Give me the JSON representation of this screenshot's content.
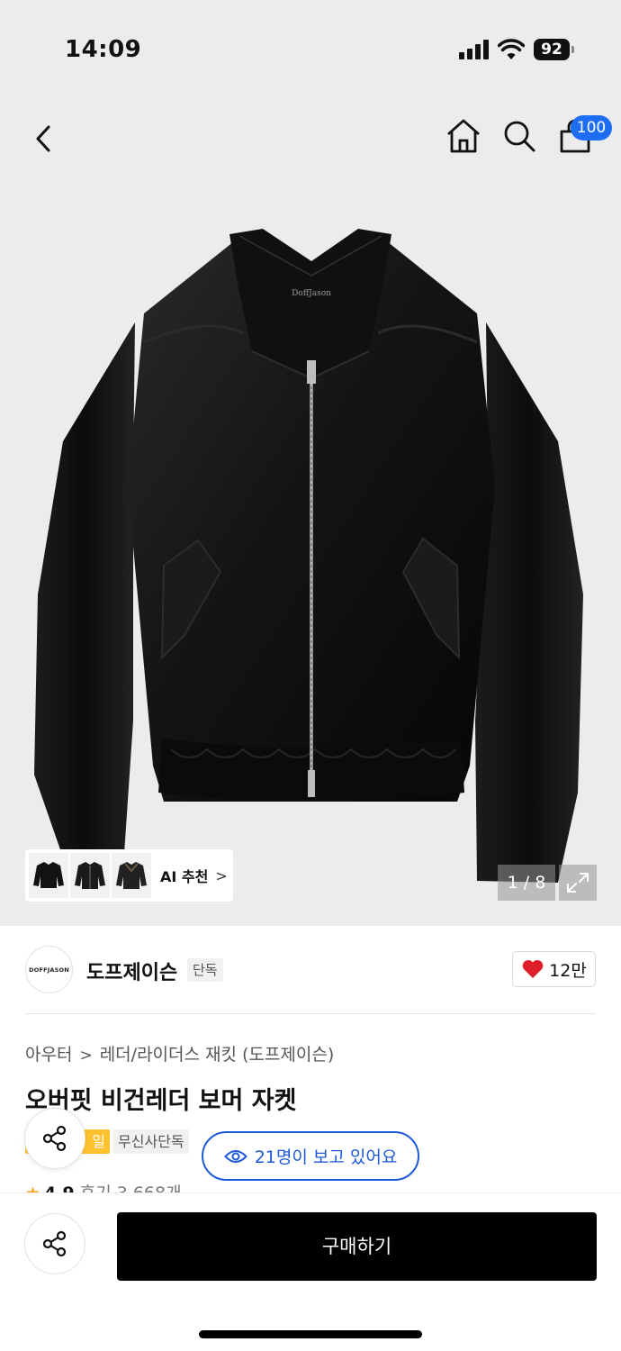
{
  "status": {
    "time": "14:09",
    "battery": "92"
  },
  "header": {
    "cart_count": "100"
  },
  "gallery": {
    "ai_label": "AI 추천",
    "ai_chevron": ">",
    "page_indicator": "1 / 8",
    "product_logo_text": "DoffJason"
  },
  "brand": {
    "logo_text": "DOFFJASON",
    "name": "도프제이슨",
    "tag": "단독",
    "likes": "12만"
  },
  "product": {
    "breadcrumb": [
      "아우터",
      "레더/라이더스 재킷 (도프제이슨)"
    ],
    "breadcrumb_sep": ">",
    "title": "오버핏 비건레더 보머 자켓",
    "badge_sale": "일",
    "badge_exclusive": "무신사단독",
    "viewers": "21명이 보고 있어요",
    "rating_star": "★",
    "rating": "4.9",
    "reviews": "후기 3,668개"
  },
  "actions": {
    "buy_label": "구매하기"
  },
  "icons": [
    "back-icon",
    "home-icon",
    "search-icon",
    "cart-icon",
    "expand-icon",
    "heart-icon",
    "eye-icon",
    "share-icon"
  ],
  "colors": {
    "accent": "#1e5ad8",
    "badge_blue": "#1e6ef4",
    "heart": "#e01e2b",
    "sale_badge": "#ffc12d",
    "buy_button": "#000000"
  }
}
